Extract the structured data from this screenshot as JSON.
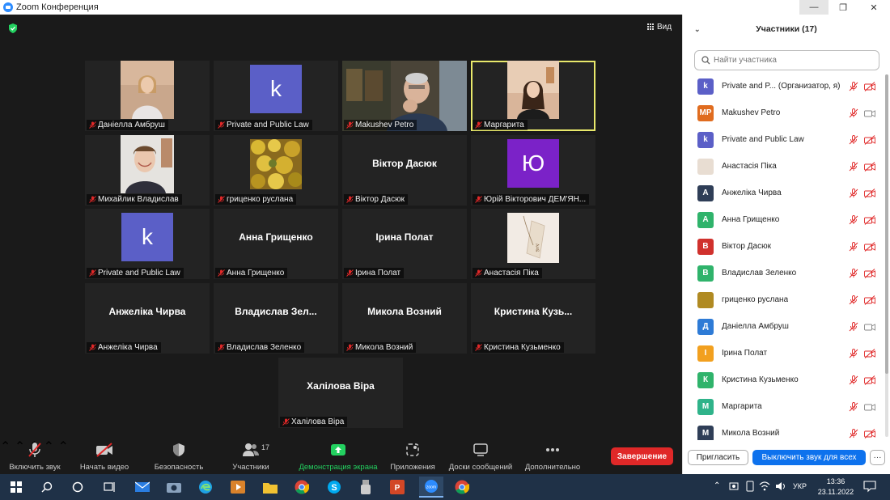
{
  "window": {
    "title": "Zoom Конференция",
    "min": "—",
    "max": "❐",
    "close": "✕"
  },
  "meeting": {
    "view_label": "Вид",
    "tiles": [
      {
        "name": "Даніелла Амбруш",
        "kind": "photo",
        "photo": "woman"
      },
      {
        "name": "Private and Public Law",
        "kind": "avatar",
        "letter": "k",
        "color": "#5b5fc7"
      },
      {
        "name": "Makushev Petro",
        "kind": "photo",
        "photo": "man"
      },
      {
        "name": "Маргарита",
        "kind": "photo",
        "photo": "girl",
        "active": true
      },
      {
        "name": "Михайлик Владислав",
        "kind": "photo",
        "photo": "boy"
      },
      {
        "name": "гриценко руслана",
        "kind": "photo",
        "photo": "leaves"
      },
      {
        "name": "Віктор Дасюк",
        "kind": "text",
        "big": "Віктор Дасюк"
      },
      {
        "name": "Юрій Вікторович ДЕМ'ЯН...",
        "kind": "avatar",
        "letter": "Ю",
        "color": "#7b22c8"
      },
      {
        "name": "Private and Public Law",
        "kind": "avatar",
        "letter": "k",
        "color": "#5b5fc7"
      },
      {
        "name": "Анна Грищенко",
        "kind": "text",
        "big": "Анна Грищенко"
      },
      {
        "name": "Ірина Полат",
        "kind": "text",
        "big": "Ірина Полат"
      },
      {
        "name": "Анастасія Піка",
        "kind": "photo",
        "photo": "card"
      },
      {
        "name": "Анжеліка Чирва",
        "kind": "text",
        "big": "Анжеліка Чирва"
      },
      {
        "name": "Владислав Зеленко",
        "kind": "text",
        "big": "Владислав  Зел..."
      },
      {
        "name": "Микола Возний",
        "kind": "text",
        "big": "Микола Возний"
      },
      {
        "name": "Кристина Кузьменко",
        "kind": "text",
        "big": "Кристина  Кузь..."
      },
      {
        "name": "Халілова Віра",
        "kind": "text",
        "big": "Халілова Віра"
      }
    ]
  },
  "toolbar": {
    "unmute": "Включить звук",
    "start_video": "Начать видео",
    "security": "Безопасность",
    "participants": "Участники",
    "participants_count": "17",
    "share": "Демонстрация экрана",
    "apps": "Приложения",
    "whiteboards": "Доски сообщений",
    "more": "Дополнительно",
    "end": "Завершение"
  },
  "panel": {
    "title": "Участники (17)",
    "search_placeholder": "Найти участника",
    "participants": [
      {
        "initials": "k",
        "name": "Private and P... (Организатор, я)",
        "color": "#5b5fc7",
        "cam": "off"
      },
      {
        "initials": "MP",
        "name": "Makushev Petro",
        "color": "#e06c1f",
        "cam": "on"
      },
      {
        "initials": "k",
        "name": "Private and Public Law",
        "color": "#5b5fc7",
        "cam": "off"
      },
      {
        "initials": "",
        "name": "Анастасія Піка",
        "color": "#e8ddd2",
        "cam": "off"
      },
      {
        "initials": "А",
        "name": "Анжеліка Чирва",
        "color": "#2f3e57",
        "cam": "off"
      },
      {
        "initials": "А",
        "name": "Анна Грищенко",
        "color": "#2fb36b",
        "cam": "off"
      },
      {
        "initials": "В",
        "name": "Віктор Дасюк",
        "color": "#d0312d",
        "cam": "off"
      },
      {
        "initials": "В",
        "name": "Владислав Зеленко",
        "color": "#2fb36b",
        "cam": "off"
      },
      {
        "initials": "",
        "name": "гриценко руслана",
        "color": "#b08a22",
        "cam": "off"
      },
      {
        "initials": "Д",
        "name": "Даніелла Амбруш",
        "color": "#2e7bd6",
        "cam": "on"
      },
      {
        "initials": "І",
        "name": "Ірина Полат",
        "color": "#f2a01f",
        "cam": "off"
      },
      {
        "initials": "К",
        "name": "Кристина Кузьменко",
        "color": "#2fb36b",
        "cam": "off"
      },
      {
        "initials": "М",
        "name": "Маргарита",
        "color": "#2fb38a",
        "cam": "on"
      },
      {
        "initials": "М",
        "name": "Микола Возний",
        "color": "#2f3e57",
        "cam": "off"
      }
    ],
    "invite": "Пригласить",
    "mute_all": "Выключить звук для всех",
    "more": "···"
  },
  "taskbar": {
    "lang": "УКР",
    "time": "13:36",
    "date": "23.11.2022"
  }
}
